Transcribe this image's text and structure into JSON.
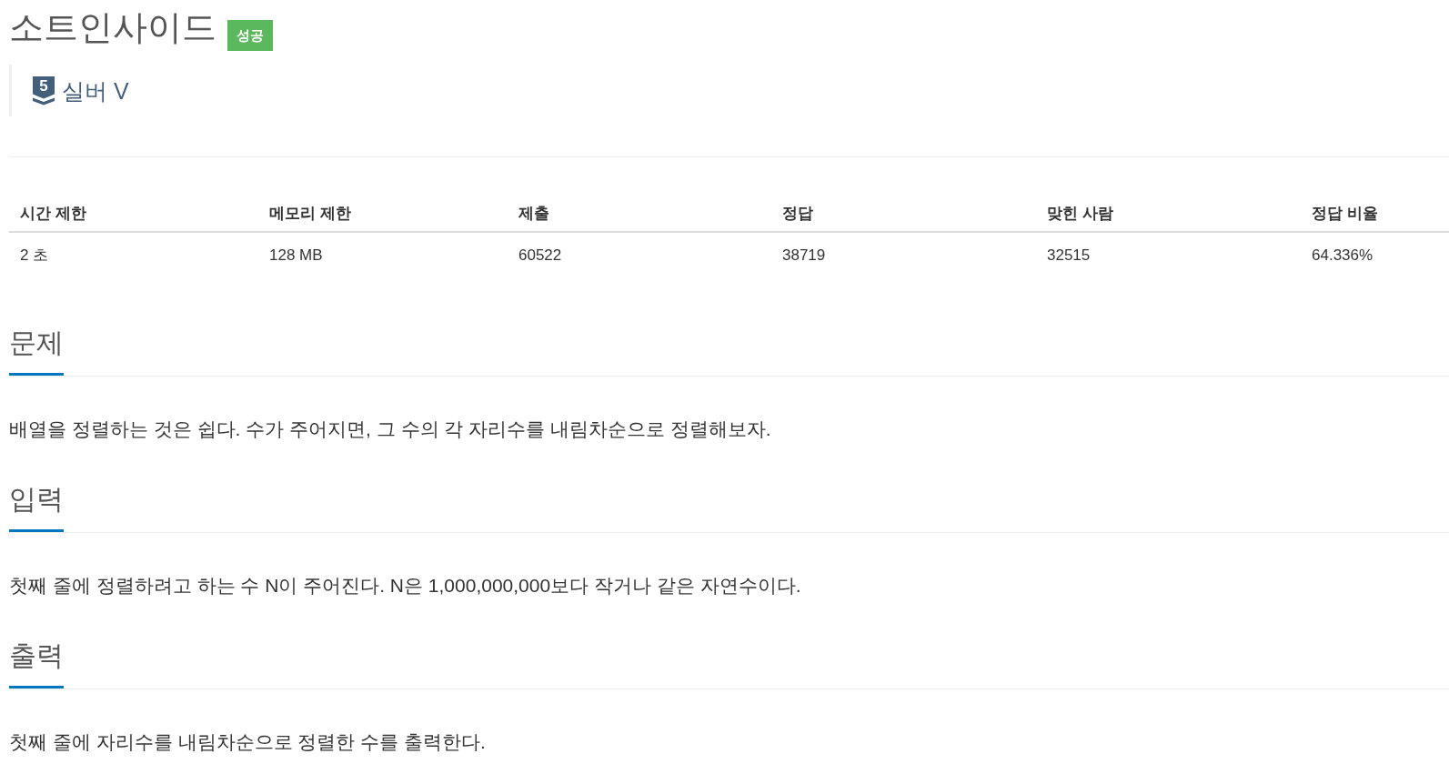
{
  "problem": {
    "title": "소트인사이드",
    "result_badge": {
      "text": "성공",
      "kind": "success"
    }
  },
  "tier": {
    "number": "5",
    "name": "실버 V"
  },
  "stats_table": {
    "columns": [
      "시간 제한",
      "메모리 제한",
      "제출",
      "정답",
      "맞힌 사람",
      "정답 비율"
    ],
    "rows": [
      [
        "2 초",
        "128 MB",
        "60522",
        "38719",
        "32515",
        "64.336%"
      ]
    ]
  },
  "sections": [
    {
      "heading": "문제",
      "body": "배열을 정렬하는 것은 쉽다. 수가 주어지면, 그 수의 각 자리수를 내림차순으로 정렬해보자."
    },
    {
      "heading": "입력",
      "body": "첫째 줄에 정렬하려고 하는 수 N이 주어진다. N은 1,000,000,000보다 작거나 같은 자연수이다."
    },
    {
      "heading": "출력",
      "body": "첫째 줄에 자리수를 내림차순으로 정렬한 수를 출력한다."
    }
  ]
}
